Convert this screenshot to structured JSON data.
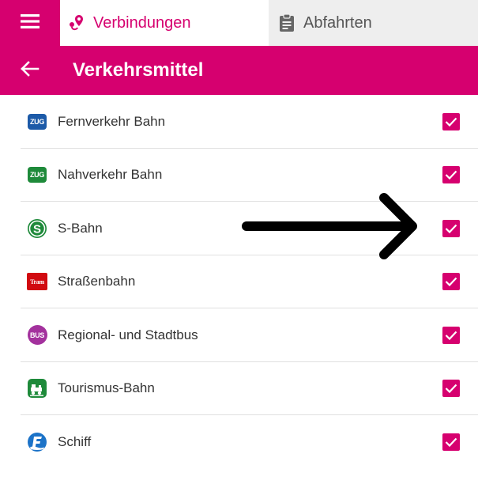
{
  "topbar": {
    "tab_connections": "Verbindungen",
    "tab_departures": "Abfahrten"
  },
  "header": {
    "title": "Verkehrsmittel"
  },
  "transport_modes": [
    {
      "label": "Fernverkehr Bahn",
      "badge": "ZUG",
      "checked": true
    },
    {
      "label": "Nahverkehr Bahn",
      "badge": "ZUG",
      "checked": true
    },
    {
      "label": "S-Bahn",
      "badge": "S",
      "checked": true
    },
    {
      "label": "Straßenbahn",
      "badge": "Tram",
      "checked": true
    },
    {
      "label": "Regional- und Stadtbus",
      "badge": "BUS",
      "checked": true
    },
    {
      "label": "Tourismus-Bahn",
      "badge": "",
      "checked": true
    },
    {
      "label": "Schiff",
      "badge": "",
      "checked": true
    }
  ],
  "colors": {
    "accent": "#d6006f",
    "fernverkehr": "#1c5aa8",
    "nahverkehr": "#1e8a3a",
    "sbahn": "#1e8a3a",
    "tram": "#d10a10",
    "bus": "#a3319d",
    "tourismus": "#1e8a3a",
    "schiff": "#1c73c8"
  },
  "icons": {
    "menu": "hamburger-icon",
    "connections": "route-pin-icon",
    "departures": "clipboard-icon",
    "back": "arrow-left-icon"
  }
}
